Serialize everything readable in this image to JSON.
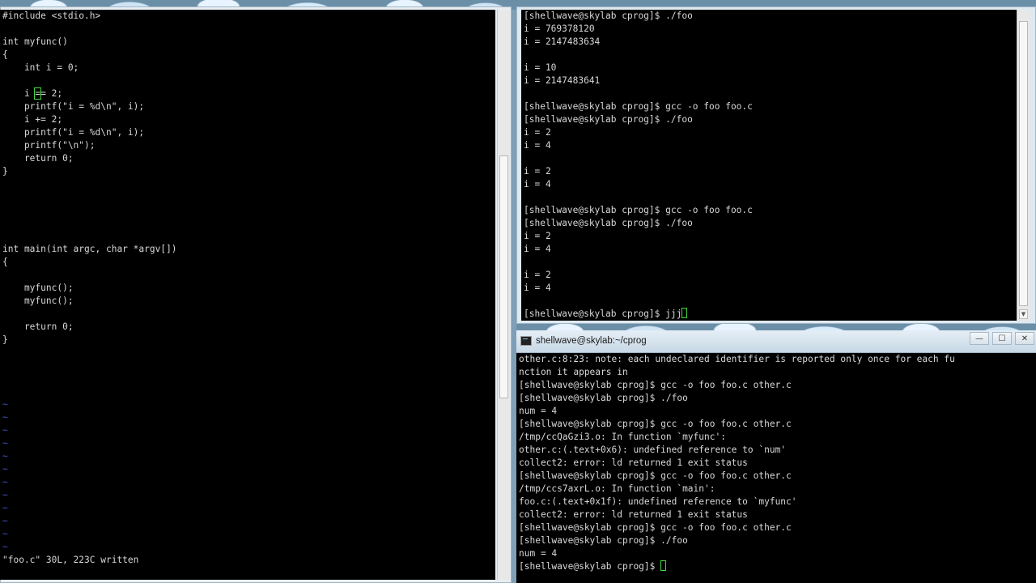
{
  "vim": {
    "lines": [
      "#include <stdio.h>",
      "",
      "int myfunc()",
      "{",
      "    int i = 0;",
      "",
      "    i ",
      "    printf(\"i = %d\\n\", i);",
      "    i += 2;",
      "    printf(\"i = %d\\n\", i);",
      "    printf(\"\\n\");",
      "    return 0;",
      "}",
      "",
      "",
      "",
      "",
      "",
      "int main(int argc, char *argv[])",
      "{",
      "",
      "    myfunc();",
      "    myfunc();",
      "",
      "    return 0;",
      "}"
    ],
    "cursor_line": {
      "before": "    i ",
      "cursor_char": "=",
      "after": "= 2;"
    },
    "tilde": "~",
    "status": "\"foo.c\" 30L, 223C written"
  },
  "term_top": {
    "lines": [
      "[shellwave@skylab cprog]$ ./foo",
      "i = 769378120",
      "i = 2147483634",
      "",
      "i = 10",
      "i = 2147483641",
      "",
      "[shellwave@skylab cprog]$ gcc -o foo foo.c",
      "[shellwave@skylab cprog]$ ./foo",
      "i = 2",
      "i = 4",
      "",
      "i = 2",
      "i = 4",
      "",
      "[shellwave@skylab cprog]$ gcc -o foo foo.c",
      "[shellwave@skylab cprog]$ ./foo",
      "i = 2",
      "i = 4",
      "",
      "i = 2",
      "i = 4",
      ""
    ],
    "prompt_line": "[shellwave@skylab cprog]$ jjj"
  },
  "term_bottom": {
    "title": "shellwave@skylab:~/cprog",
    "buttons": {
      "minimize": "—",
      "maximize": "☐",
      "close": "✕"
    },
    "lines": [
      "other.c:8:23: note: each undeclared identifier is reported only once for each fu",
      "nction it appears in",
      "[shellwave@skylab cprog]$ gcc -o foo foo.c other.c",
      "[shellwave@skylab cprog]$ ./foo",
      "num = 4",
      "[shellwave@skylab cprog]$ gcc -o foo foo.c other.c",
      "/tmp/ccQaGzi3.o: In function `myfunc':",
      "other.c:(.text+0x6): undefined reference to `num'",
      "collect2: error: ld returned 1 exit status",
      "[shellwave@skylab cprog]$ gcc -o foo foo.c other.c",
      "/tmp/ccs7axrL.o: In function `main':",
      "foo.c:(.text+0x1f): undefined reference to `myfunc'",
      "collect2: error: ld returned 1 exit status",
      "[shellwave@skylab cprog]$ gcc -o foo foo.c other.c",
      "[shellwave@skylab cprog]$ ./foo",
      "num = 4"
    ],
    "prompt_line": "[shellwave@skylab cprog]$ "
  },
  "scroll_arrows": {
    "up": "▲",
    "down": "▼"
  }
}
